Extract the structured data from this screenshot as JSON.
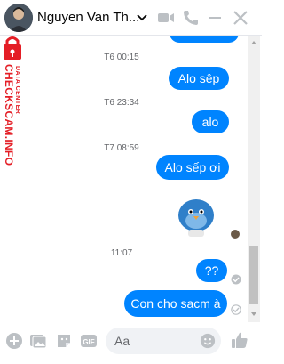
{
  "header": {
    "contact_name": "Nguyen Van Th...",
    "icons": [
      "chevron-down-icon",
      "video-camera-icon",
      "phone-icon",
      "minimize-icon",
      "close-icon"
    ]
  },
  "watermark": {
    "line1": "DATA CENTER",
    "line2": "CHECKSCAM.INFO"
  },
  "messages": [
    {
      "type": "timestamp",
      "text": "T6 00:15"
    },
    {
      "type": "sent",
      "text": "Alo sêp"
    },
    {
      "type": "timestamp",
      "text": "T6 23:34"
    },
    {
      "type": "sent",
      "text": "alo"
    },
    {
      "type": "timestamp",
      "text": "T7 08:59"
    },
    {
      "type": "sent",
      "text": "Alo sếp ơi"
    },
    {
      "type": "received_sticker",
      "sticker": "blue-bird-sticker"
    },
    {
      "type": "timestamp",
      "text": "11:07"
    },
    {
      "type": "sent",
      "text": "??"
    },
    {
      "type": "sent",
      "text": "Con cho sacm à"
    }
  ],
  "composer": {
    "placeholder": "Aa",
    "icons": [
      "plus-icon",
      "image-icon",
      "sticker-icon",
      "gif-icon",
      "emoji-icon",
      "like-icon"
    ]
  },
  "colors": {
    "accent": "#0084ff",
    "icon_gray": "#bcc0c4",
    "watermark_red": "#e41e26"
  }
}
